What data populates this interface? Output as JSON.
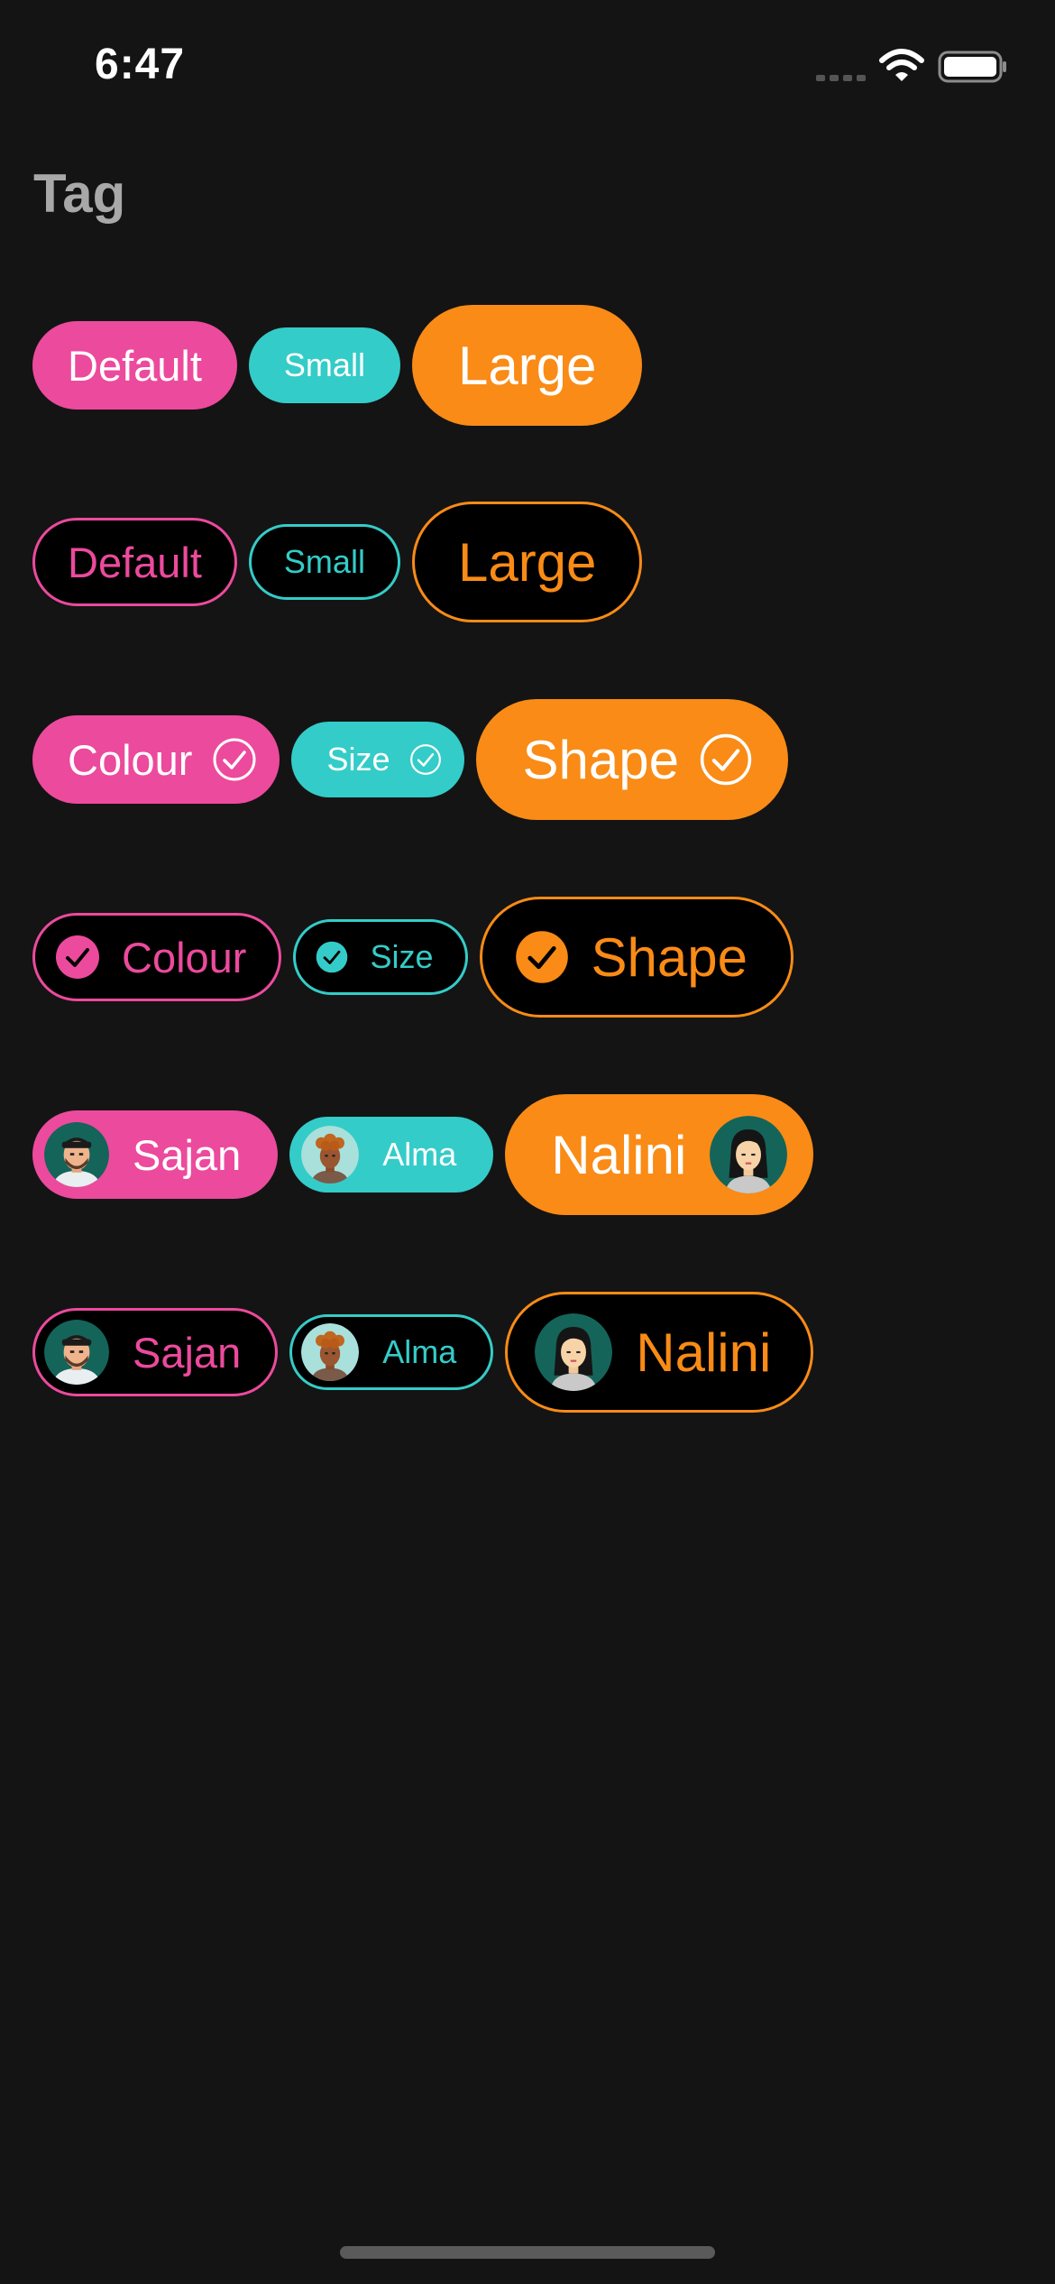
{
  "status": {
    "time": "6:47"
  },
  "page": {
    "title": "Tag"
  },
  "rows": {
    "filled_basic": {
      "default": "Default",
      "small": "Small",
      "large": "Large"
    },
    "outline_basic": {
      "default": "Default",
      "small": "Small",
      "large": "Large"
    },
    "filled_check": {
      "colour": "Colour",
      "size": "Size",
      "shape": "Shape"
    },
    "outline_check": {
      "colour": "Colour",
      "size": "Size",
      "shape": "Shape"
    },
    "filled_avatar": {
      "sajan": "Sajan",
      "alma": "Alma",
      "nalini": "Nalini"
    },
    "outline_avatar": {
      "sajan": "Sajan",
      "alma": "Alma",
      "nalini": "Nalini"
    }
  },
  "colors": {
    "background": "#141414",
    "pink": "#ec4a9d",
    "teal": "#34ccc8",
    "orange": "#f98b16",
    "title": "#a8a8a8"
  }
}
